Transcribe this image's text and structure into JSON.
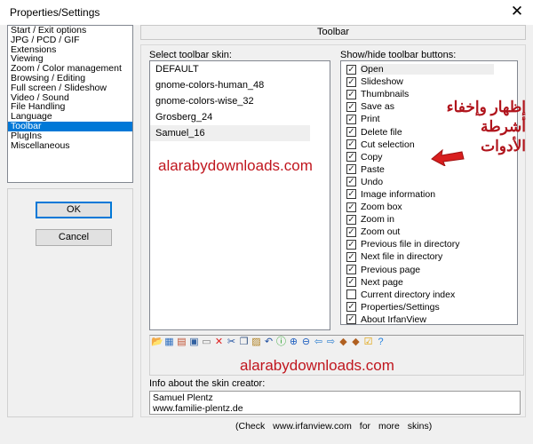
{
  "window": {
    "title": "Properties/Settings",
    "close": "✕"
  },
  "categories": [
    "Start / Exit options",
    "JPG / PCD / GIF",
    "Extensions",
    "Viewing",
    "Zoom / Color management",
    "Browsing / Editing",
    "Full screen / Slideshow",
    "Video / Sound",
    "File Handling",
    "Language",
    "Toolbar",
    "PlugIns",
    "Miscellaneous"
  ],
  "selected_category": "Toolbar",
  "buttons": {
    "ok": "OK",
    "cancel": "Cancel"
  },
  "panel": {
    "header": "Toolbar",
    "skin_label": "Select toolbar skin:",
    "buttons_label": "Show/hide toolbar buttons:"
  },
  "skins": [
    "DEFAULT",
    "gnome-colors-human_48",
    "gnome-colors-wise_32",
    "Grosberg_24",
    "Samuel_16"
  ],
  "selected_skin": "Samuel_16",
  "toolbar_buttons": [
    {
      "label": "Open",
      "checked": true
    },
    {
      "label": "Slideshow",
      "checked": true
    },
    {
      "label": "Thumbnails",
      "checked": true
    },
    {
      "label": "Save as",
      "checked": true
    },
    {
      "label": "Print",
      "checked": true
    },
    {
      "label": "Delete file",
      "checked": true
    },
    {
      "label": "Cut selection",
      "checked": true
    },
    {
      "label": "Copy",
      "checked": true
    },
    {
      "label": "Paste",
      "checked": true
    },
    {
      "label": "Undo",
      "checked": true
    },
    {
      "label": "Image information",
      "checked": true
    },
    {
      "label": "Zoom box",
      "checked": true
    },
    {
      "label": "Zoom in",
      "checked": true
    },
    {
      "label": "Zoom out",
      "checked": true
    },
    {
      "label": "Previous file in directory",
      "checked": true
    },
    {
      "label": "Next file in directory",
      "checked": true
    },
    {
      "label": "Previous page",
      "checked": true
    },
    {
      "label": "Next page",
      "checked": true
    },
    {
      "label": "Current directory index",
      "checked": false
    },
    {
      "label": "Properties/Settings",
      "checked": true
    },
    {
      "label": "About IrfanView",
      "checked": true
    }
  ],
  "toolbar_preview_icons": [
    {
      "name": "open-folder-icon",
      "glyph": "📂",
      "color": "#d9a400"
    },
    {
      "name": "slideshow-icon",
      "glyph": "▦",
      "color": "#3070c0"
    },
    {
      "name": "thumbnails-icon",
      "glyph": "▤",
      "color": "#c05030"
    },
    {
      "name": "save-icon",
      "glyph": "▣",
      "color": "#3060a0"
    },
    {
      "name": "print-icon",
      "glyph": "▭",
      "color": "#777777"
    },
    {
      "name": "delete-icon",
      "glyph": "✕",
      "color": "#e02020"
    },
    {
      "name": "cut-icon",
      "glyph": "✂",
      "color": "#2050a0"
    },
    {
      "name": "copy-icon",
      "glyph": "❐",
      "color": "#305080"
    },
    {
      "name": "paste-icon",
      "glyph": "▨",
      "color": "#b08020"
    },
    {
      "name": "undo-icon",
      "glyph": "↶",
      "color": "#2050a0"
    },
    {
      "name": "info-icon",
      "glyph": "ⓘ",
      "color": "#20a020"
    },
    {
      "name": "zoom-in-icon",
      "glyph": "⊕",
      "color": "#2060c0"
    },
    {
      "name": "zoom-out-icon",
      "glyph": "⊖",
      "color": "#2060c0"
    },
    {
      "name": "previous-file-icon",
      "glyph": "⇦",
      "color": "#3080d0"
    },
    {
      "name": "next-file-icon",
      "glyph": "⇨",
      "color": "#3080d0"
    },
    {
      "name": "previous-page-icon",
      "glyph": "◆",
      "color": "#b06020"
    },
    {
      "name": "next-page-icon",
      "glyph": "◆",
      "color": "#b06020"
    },
    {
      "name": "settings-check-icon",
      "glyph": "☑",
      "color": "#e0a000"
    },
    {
      "name": "help-icon",
      "glyph": "?",
      "color": "#2080e0"
    }
  ],
  "info": {
    "label": "Info about the skin creator:",
    "name": "Samuel Plentz",
    "site": "www.familie-plentz.de"
  },
  "check_text": "(Check www.irfanview.com for more skins)",
  "watermark": "alarabydownloads.com",
  "annotation": {
    "line1": "إظهار وإخفاء",
    "line2": "أشرطة الأدوات",
    "color": "#c0161e"
  }
}
